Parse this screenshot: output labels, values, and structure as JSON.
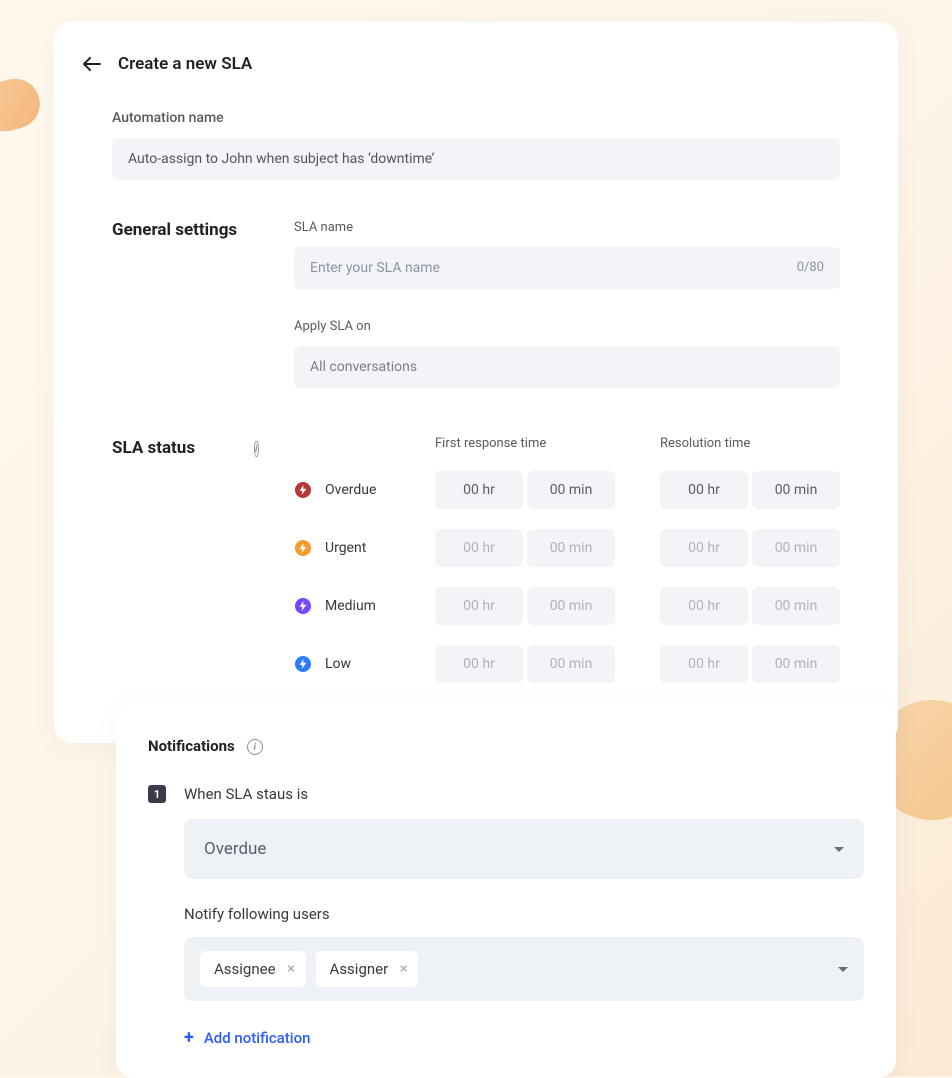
{
  "colors": {
    "overdue": "#b53939",
    "urgent": "#f39c2e",
    "medium": "#7548ff",
    "low": "#2d7bff",
    "accent_blue": "#2d5bff"
  },
  "header": {
    "title": "Create a new SLA"
  },
  "automation": {
    "label": "Automation name",
    "value": "Auto-assign to John when subject has ‘downtime’"
  },
  "general": {
    "section_title": "General settings",
    "sla_name_label": "SLA name",
    "sla_name_placeholder": "Enter your SLA name",
    "sla_name_value": "",
    "sla_name_count": "0/80",
    "apply_label": "Apply SLA on",
    "apply_value": "All conversations"
  },
  "sla_status": {
    "section_title": "SLA status",
    "col_first_response": "First response time",
    "col_resolution": "Resolution time",
    "rows": [
      {
        "label": "Overdue",
        "color": "#b53939",
        "fr_hr": "00 hr",
        "fr_min": "00 min",
        "res_hr": "00 hr",
        "res_min": "00 min",
        "active": true
      },
      {
        "label": "Urgent",
        "color": "#f39c2e",
        "fr_hr": "00 hr",
        "fr_min": "00 min",
        "res_hr": "00 hr",
        "res_min": "00 min",
        "active": false
      },
      {
        "label": "Medium",
        "color": "#7548ff",
        "fr_hr": "00 hr",
        "fr_min": "00 min",
        "res_hr": "00 hr",
        "res_min": "00 min",
        "active": false
      },
      {
        "label": "Low",
        "color": "#2d7bff",
        "fr_hr": "00 hr",
        "fr_min": "00 min",
        "res_hr": "00 hr",
        "res_min": "00 min",
        "active": false
      }
    ]
  },
  "notifications": {
    "section_title": "Notifications",
    "step_num": "1",
    "when_label": "When SLA staus is",
    "status_value": "Overdue",
    "notify_label": "Notify following users",
    "chips": [
      "Assignee",
      "Assigner"
    ],
    "add_label": "Add notification"
  }
}
